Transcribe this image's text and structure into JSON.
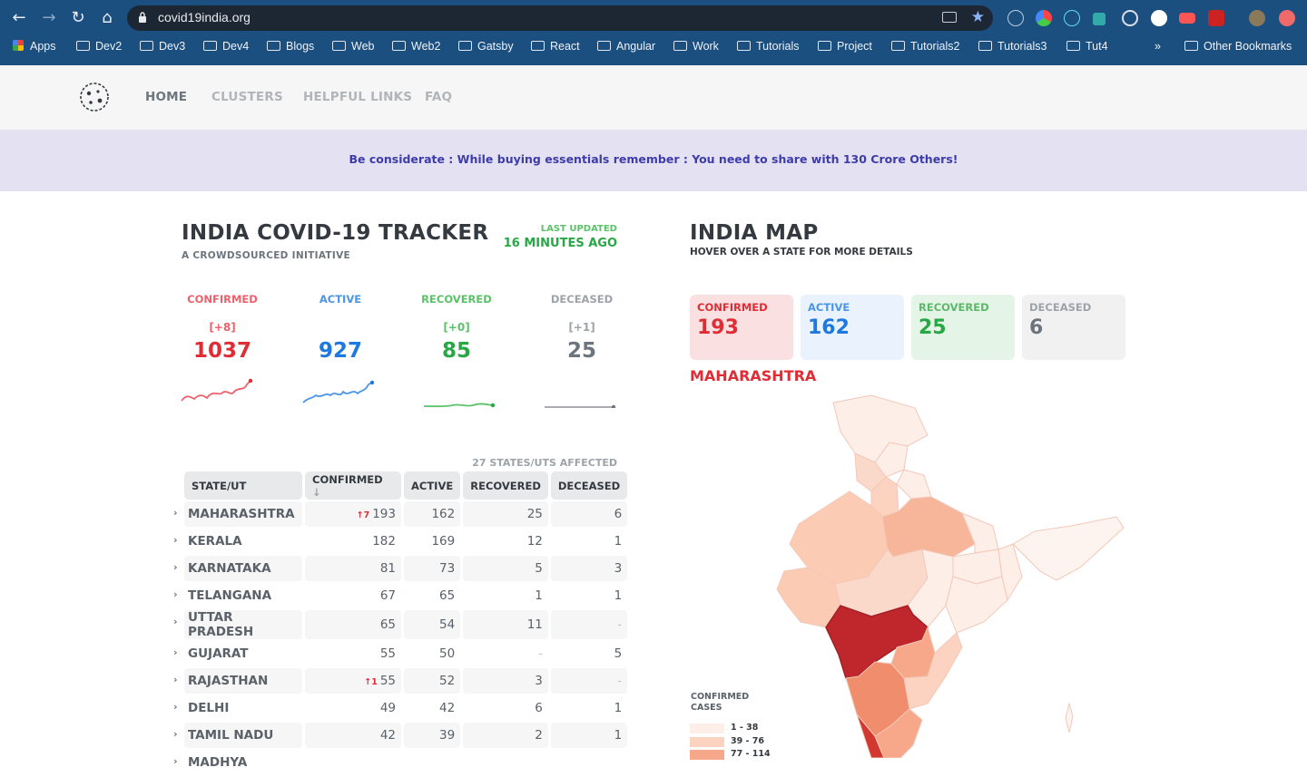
{
  "browser": {
    "url": "covid19india.org",
    "bookmarks": [
      "Apps",
      "Dev2",
      "Dev3",
      "Dev4",
      "Blogs",
      "Web",
      "Web2",
      "Gatsby",
      "React",
      "Angular",
      "Work",
      "Tutorials",
      "Project",
      "Tutorials2",
      "Tutorials3",
      "Tut4"
    ],
    "overflow": "»",
    "other_bookmarks": "Other Bookmarks"
  },
  "nav": {
    "links": [
      "HOME",
      "CLUSTERS",
      "HELPFUL LINKS",
      "FAQ"
    ]
  },
  "banner": {
    "text": "Be considerate : While buying essentials remember : You need to share with 130 Crore Others!"
  },
  "tracker": {
    "title": "INDIA COVID-19 TRACKER",
    "subtitle": "A CROWDSOURCED INITIATIVE",
    "last_updated_label": "LAST UPDATED",
    "last_updated_value": "16 MINUTES AGO",
    "levels": [
      {
        "label": "CONFIRMED",
        "delta": "[+8]",
        "value": "1037",
        "color": "#e02d35"
      },
      {
        "label": "ACTIVE",
        "delta": "",
        "value": "927",
        "color": "#1d78e0"
      },
      {
        "label": "RECOVERED",
        "delta": "[+0]",
        "value": "85",
        "color": "#28a745"
      },
      {
        "label": "DECEASED",
        "delta": "[+1]",
        "value": "25",
        "color": "#6c757d"
      }
    ]
  },
  "table": {
    "affected": "27 STATES/UTS AFFECTED",
    "headers": [
      "STATE/UT",
      "CONFIRMED",
      "ACTIVE",
      "RECOVERED",
      "DECEASED"
    ],
    "sort_indicator": "↓",
    "rows": [
      {
        "state": "MAHARASHTRA",
        "inc": "↑7",
        "confirmed": "193",
        "active": "162",
        "recovered": "25",
        "deceased": "6"
      },
      {
        "state": "KERALA",
        "inc": "",
        "confirmed": "182",
        "active": "169",
        "recovered": "12",
        "deceased": "1"
      },
      {
        "state": "KARNATAKA",
        "inc": "",
        "confirmed": "81",
        "active": "73",
        "recovered": "5",
        "deceased": "3"
      },
      {
        "state": "TELANGANA",
        "inc": "",
        "confirmed": "67",
        "active": "65",
        "recovered": "1",
        "deceased": "1"
      },
      {
        "state": "UTTAR PRADESH",
        "inc": "",
        "confirmed": "65",
        "active": "54",
        "recovered": "11",
        "deceased": "-"
      },
      {
        "state": "GUJARAT",
        "inc": "",
        "confirmed": "55",
        "active": "50",
        "recovered": "-",
        "deceased": "5"
      },
      {
        "state": "RAJASTHAN",
        "inc": "↑1",
        "confirmed": "55",
        "active": "52",
        "recovered": "3",
        "deceased": "-"
      },
      {
        "state": "DELHI",
        "inc": "",
        "confirmed": "49",
        "active": "42",
        "recovered": "6",
        "deceased": "1"
      },
      {
        "state": "TAMIL NADU",
        "inc": "",
        "confirmed": "42",
        "active": "39",
        "recovered": "2",
        "deceased": "1"
      },
      {
        "state": "MADHYA",
        "inc": "",
        "confirmed": "",
        "active": "",
        "recovered": "",
        "deceased": ""
      }
    ]
  },
  "map": {
    "title": "INDIA MAP",
    "subtitle": "HOVER OVER A STATE FOR MORE DETAILS",
    "stats": [
      {
        "label": "CONFIRMED",
        "value": "193"
      },
      {
        "label": "ACTIVE",
        "value": "162"
      },
      {
        "label": "RECOVERED",
        "value": "25"
      },
      {
        "label": "DECEASED",
        "value": "6"
      }
    ],
    "selected_state": "MAHARASHTRA",
    "legend_title": [
      "CONFIRMED",
      "CASES"
    ],
    "legend": [
      {
        "range": "1 - 38",
        "color": "#fdeee8"
      },
      {
        "range": "39 - 76",
        "color": "#fbd3c0"
      },
      {
        "range": "77 - 114",
        "color": "#f7a88a"
      }
    ]
  }
}
